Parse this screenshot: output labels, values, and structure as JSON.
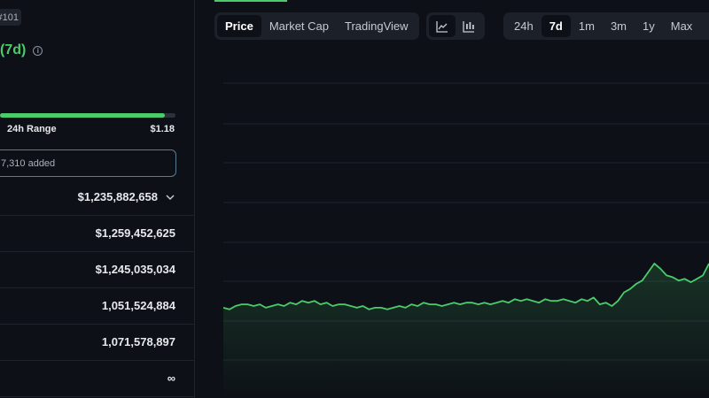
{
  "coin": {
    "rank": "#101",
    "change_label": "(7d)",
    "info_icon": "info-icon"
  },
  "range": {
    "label": "24h Range",
    "high": "$1.18",
    "fill_percent": 94
  },
  "watchlist": {
    "text": "7,310 added"
  },
  "stats": [
    {
      "value": "$1,235,882,658",
      "has_chevron": true
    },
    {
      "value": "$1,259,452,625",
      "has_chevron": false
    },
    {
      "value": "$1,245,035,034",
      "has_chevron": false
    },
    {
      "value": "1,051,524,884",
      "has_chevron": false
    },
    {
      "value": "1,071,578,897",
      "has_chevron": false
    },
    {
      "value": "∞",
      "has_chevron": false
    }
  ],
  "chart_tabs": [
    {
      "label": "Price",
      "active": true
    },
    {
      "label": "Market Cap",
      "active": false
    },
    {
      "label": "TradingView",
      "active": false
    }
  ],
  "chart_type_buttons": [
    {
      "icon": "line-chart-icon",
      "active": true
    },
    {
      "icon": "candlestick-icon",
      "active": false
    }
  ],
  "time_ranges": [
    {
      "label": "24h",
      "active": false
    },
    {
      "label": "7d",
      "active": true
    },
    {
      "label": "1m",
      "active": false
    },
    {
      "label": "3m",
      "active": false
    },
    {
      "label": "1y",
      "active": false
    },
    {
      "label": "Max",
      "active": false
    }
  ],
  "colors": {
    "accent": "#4bcc6b",
    "background": "#0d1117",
    "grid": "#1f242c"
  },
  "chart_data": {
    "type": "line",
    "grid": true,
    "y_range": [
      0,
      100
    ],
    "x": [
      0,
      1,
      2,
      3,
      4,
      5,
      6,
      7,
      8,
      9,
      10,
      11,
      12,
      13,
      14,
      15,
      16,
      17,
      18,
      19,
      20,
      21,
      22,
      23,
      24,
      25,
      26,
      27,
      28,
      29,
      30,
      31,
      32,
      33,
      34,
      35,
      36,
      37,
      38,
      39,
      40,
      41,
      42,
      43,
      44,
      45,
      46,
      47,
      48,
      49,
      50,
      51,
      52,
      53,
      54,
      55,
      56,
      57,
      58,
      59,
      60,
      61,
      62,
      63,
      64,
      65,
      66,
      67,
      68,
      69,
      70,
      71,
      72,
      73,
      74,
      75,
      76,
      77,
      78,
      79,
      80
    ],
    "values": [
      24,
      23,
      25,
      26,
      26,
      25,
      26,
      24,
      25,
      26,
      25,
      27,
      26,
      28,
      27,
      28,
      26,
      27,
      25,
      26,
      26,
      25,
      24,
      25,
      23,
      24,
      24,
      23,
      24,
      25,
      24,
      26,
      25,
      27,
      26,
      26,
      25,
      26,
      27,
      26,
      27,
      27,
      26,
      27,
      26,
      27,
      28,
      27,
      29,
      28,
      29,
      28,
      27,
      29,
      28,
      28,
      29,
      28,
      27,
      29,
      28,
      30,
      26,
      27,
      25,
      28,
      33,
      35,
      38,
      40,
      45,
      50,
      47,
      43,
      42,
      40,
      41,
      39,
      41,
      43,
      50
    ]
  }
}
